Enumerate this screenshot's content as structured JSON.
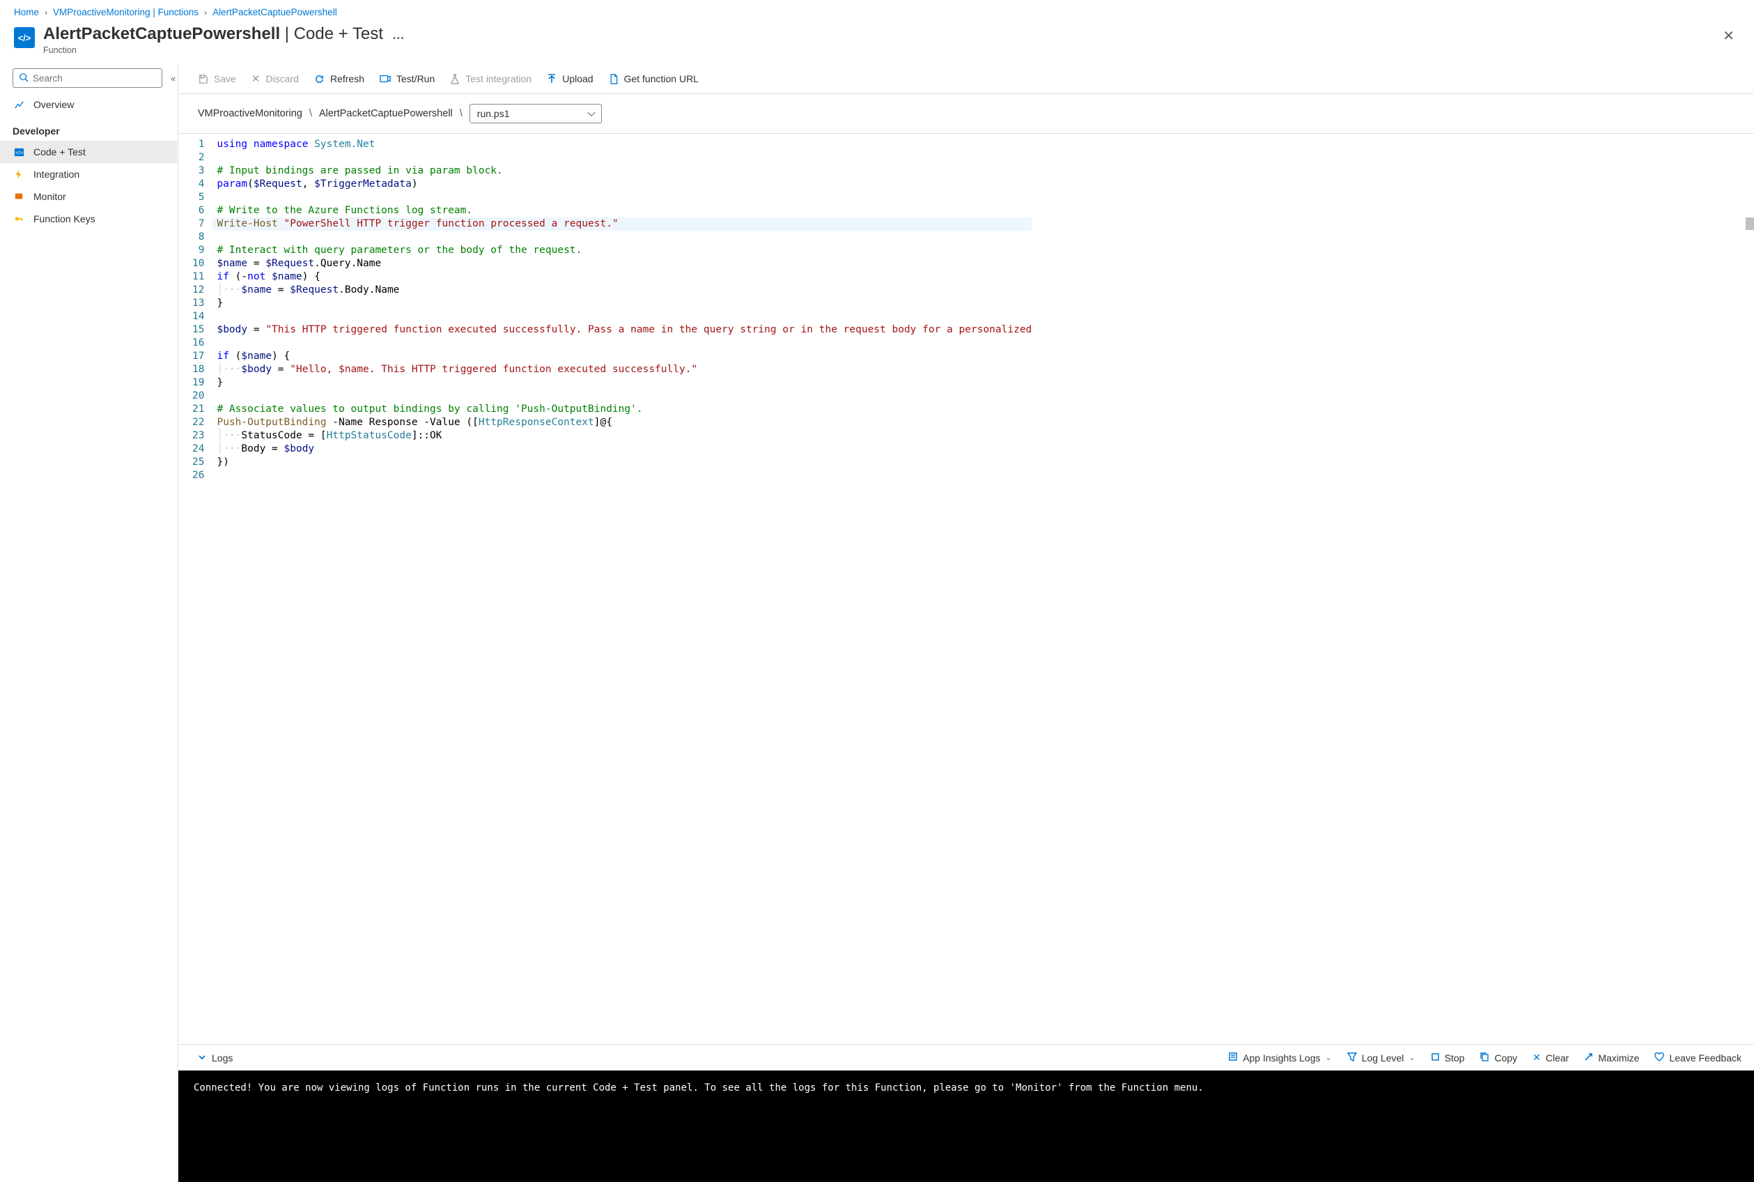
{
  "breadcrumb": {
    "home": "Home",
    "parent": "VMProactiveMonitoring | Functions",
    "current": "AlertPacketCaptuePowershell"
  },
  "header": {
    "icon_text": "</>",
    "title_strong": "AlertPacketCaptuePowershell",
    "title_sep": " | ",
    "title_light": "Code + Test",
    "subtitle": "Function"
  },
  "sidebar": {
    "search_placeholder": "Search",
    "overview_label": "Overview",
    "developer_label": "Developer",
    "items": {
      "code_test": "Code + Test",
      "integration": "Integration",
      "monitor": "Monitor",
      "function_keys": "Function Keys"
    }
  },
  "actions": {
    "save": "Save",
    "discard": "Discard",
    "refresh": "Refresh",
    "test_run": "Test/Run",
    "test_integration": "Test integration",
    "upload": "Upload",
    "get_url": "Get function URL"
  },
  "path": {
    "app": "VMProactiveMonitoring",
    "func": "AlertPacketCaptuePowershell",
    "file": "run.ps1"
  },
  "editor": {
    "highlighted_line": 7,
    "lines": [
      [
        [
          "kw",
          "using"
        ],
        [
          "",
          " "
        ],
        [
          "kw",
          "namespace"
        ],
        [
          "",
          " "
        ],
        [
          "ns",
          "System.Net"
        ]
      ],
      [],
      [
        [
          "cm",
          "# Input bindings are passed in via param block."
        ]
      ],
      [
        [
          "kw",
          "param"
        ],
        [
          "",
          "("
        ],
        [
          "var",
          "$Request"
        ],
        [
          "",
          ", "
        ],
        [
          "var",
          "$TriggerMetadata"
        ],
        [
          "",
          ")"
        ]
      ],
      [],
      [
        [
          "cm",
          "# Write to the Azure Functions log stream."
        ]
      ],
      [
        [
          "cmd",
          "Write-Host"
        ],
        [
          "",
          " "
        ],
        [
          "str",
          "\"PowerShell HTTP trigger function processed a request.\""
        ]
      ],
      [],
      [
        [
          "cm",
          "# Interact with query parameters or the body of the request."
        ]
      ],
      [
        [
          "var",
          "$name"
        ],
        [
          "",
          " = "
        ],
        [
          "var",
          "$Request"
        ],
        [
          "",
          ".Query.Name"
        ]
      ],
      [
        [
          "kw",
          "if"
        ],
        [
          "",
          " (-"
        ],
        [
          "kw",
          "not"
        ],
        [
          "",
          " "
        ],
        [
          "var",
          "$name"
        ],
        [
          "",
          ") {"
        ]
      ],
      [
        [
          "ws",
          "    "
        ],
        [
          "var",
          "$name"
        ],
        [
          "",
          " = "
        ],
        [
          "var",
          "$Request"
        ],
        [
          "",
          ".Body.Name"
        ]
      ],
      [
        [
          "",
          "}"
        ]
      ],
      [],
      [
        [
          "var",
          "$body"
        ],
        [
          "",
          " = "
        ],
        [
          "str",
          "\"This HTTP triggered function executed successfully. Pass a name in the query string or in the request body for a personalized"
        ]
      ],
      [],
      [
        [
          "kw",
          "if"
        ],
        [
          "",
          " ("
        ],
        [
          "var",
          "$name"
        ],
        [
          "",
          ") {"
        ]
      ],
      [
        [
          "ws",
          "    "
        ],
        [
          "var",
          "$body"
        ],
        [
          "",
          " = "
        ],
        [
          "str",
          "\"Hello, $name. This HTTP triggered function executed successfully.\""
        ]
      ],
      [
        [
          "",
          "}"
        ]
      ],
      [],
      [
        [
          "cm",
          "# Associate values to output bindings by calling 'Push-OutputBinding'."
        ]
      ],
      [
        [
          "cmd",
          "Push-OutputBinding"
        ],
        [
          "",
          " -Name Response -Value (["
        ],
        [
          "type",
          "HttpResponseContext"
        ],
        [
          "",
          "]@{"
        ]
      ],
      [
        [
          "ws",
          "    "
        ],
        [
          "",
          "StatusCode = ["
        ],
        [
          "type",
          "HttpStatusCode"
        ],
        [
          "",
          "]::OK"
        ]
      ],
      [
        [
          "ws",
          "    "
        ],
        [
          "",
          "Body = "
        ],
        [
          "var",
          "$body"
        ]
      ],
      [
        [
          "",
          "})"
        ]
      ],
      []
    ]
  },
  "logs": {
    "collapse_label": "Logs",
    "app_insights": "App Insights Logs",
    "log_level": "Log Level",
    "stop": "Stop",
    "copy": "Copy",
    "clear": "Clear",
    "maximize": "Maximize",
    "feedback": "Leave Feedback"
  },
  "console_text": "Connected! You are now viewing logs of Function runs in the current Code + Test panel. To see all the logs for this Function, please go to 'Monitor' from the Function menu."
}
